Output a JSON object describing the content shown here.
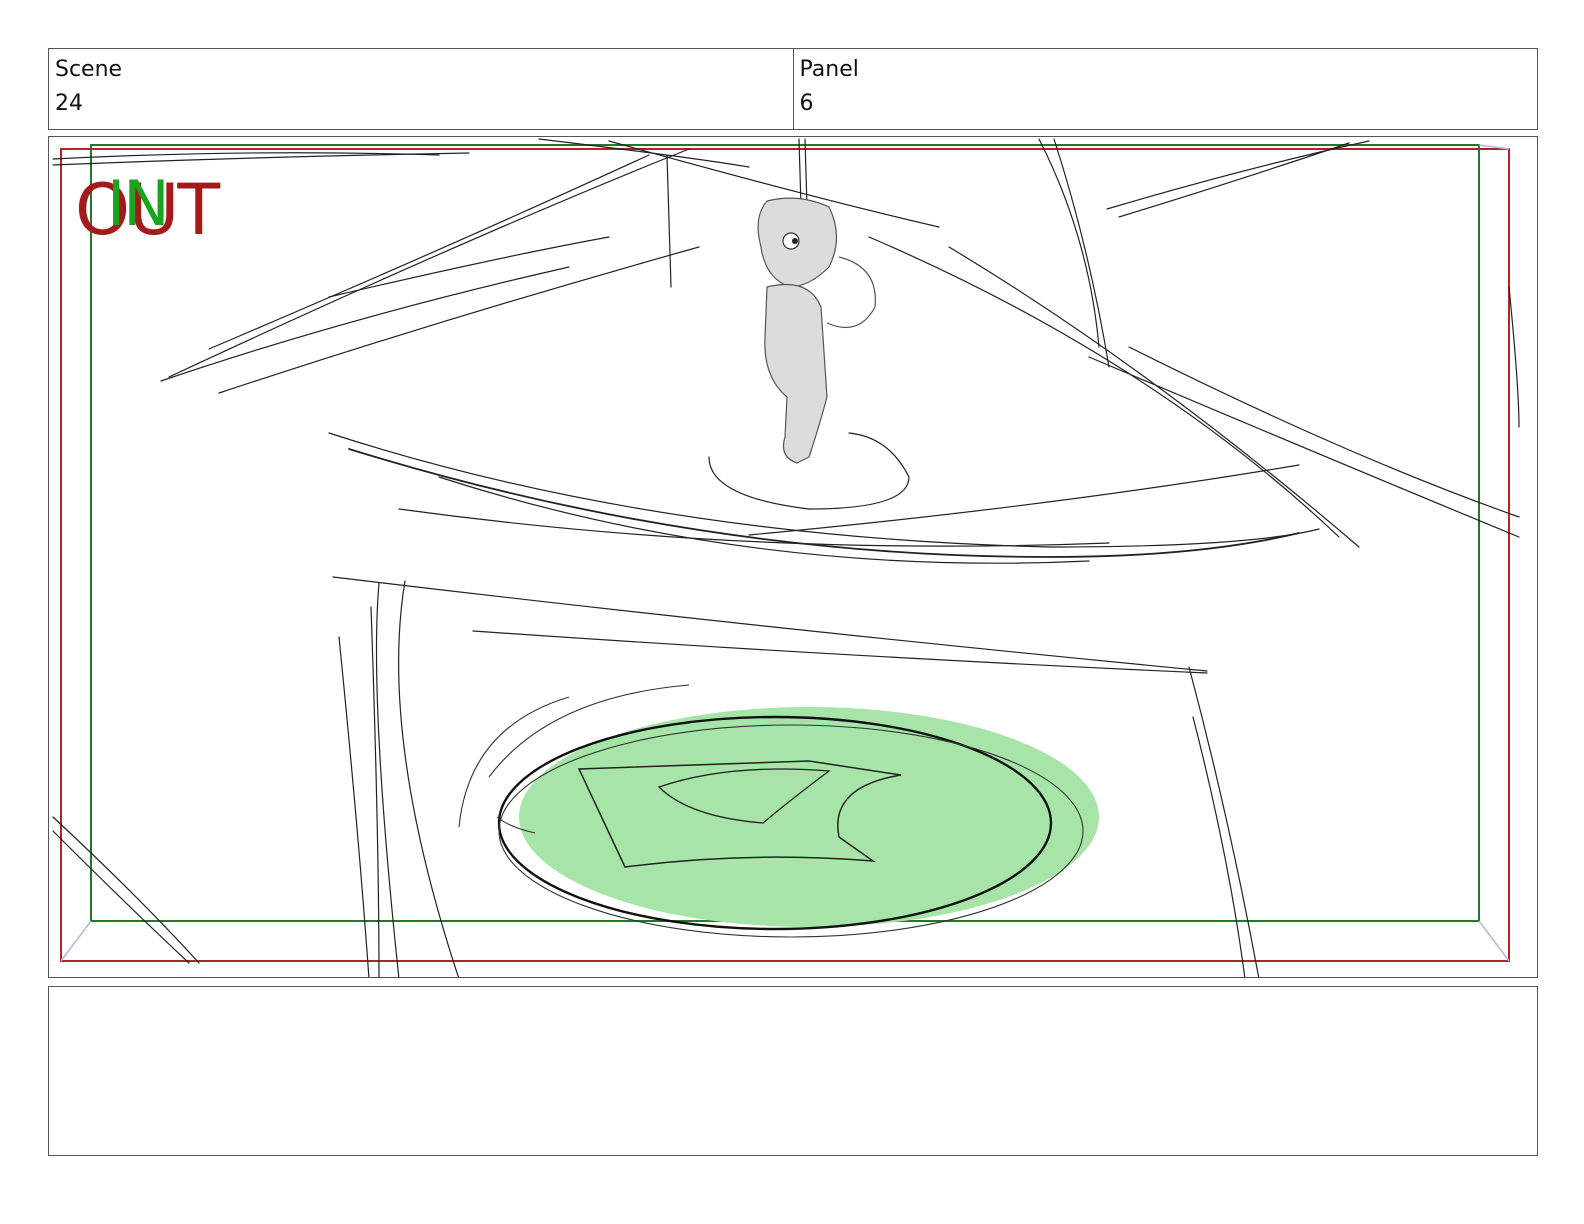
{
  "header": {
    "scene_label": "Scene",
    "scene_value": "24",
    "panel_label": "Panel",
    "panel_value": "6"
  },
  "frame": {
    "out_tag": "OUT",
    "in_tag": "IN",
    "colors": {
      "out_frame": "#b3232a",
      "in_frame": "#1f7a2a",
      "glow_fill": "#a6e4a8",
      "sketch_line": "#222222"
    }
  },
  "notes": {
    "text": ""
  }
}
